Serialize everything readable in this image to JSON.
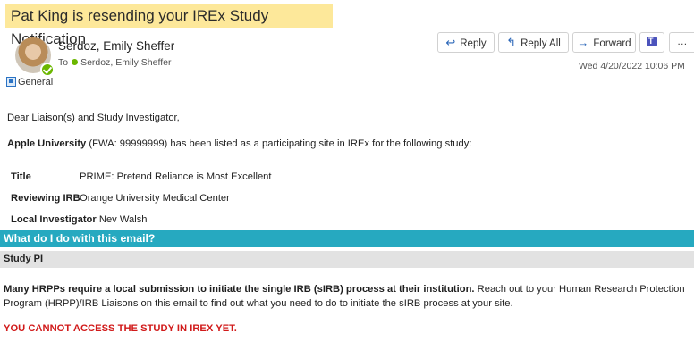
{
  "email": {
    "subject": "Pat King is resending your IREx Study Notification",
    "sender_name": "Serdoz, Emily Sheffer",
    "to_label": "To",
    "to_name": "Serdoz, Emily Sheffer",
    "category": "General",
    "date": "Wed 4/20/2022 10:06 PM"
  },
  "actions": {
    "reply": "Reply",
    "reply_all": "Reply All",
    "forward": "Forward",
    "more": "…"
  },
  "body": {
    "greeting": "Dear Liaison(s) and Study Investigator,",
    "institution": "Apple University",
    "intro_rest": " (FWA: 99999999) has been listed as a participating site in IREx for the following study:",
    "rows": [
      {
        "label": "Title",
        "value": "PRIME: Pretend Reliance is Most Excellent"
      },
      {
        "label": "Reviewing IRB",
        "value": "Orange University Medical Center"
      },
      {
        "label": "Local Investigator",
        "value": "Nev Walsh"
      }
    ],
    "section_heading": "What do I do with this email?",
    "subsection": "Study PI",
    "para_bold": "Many HRPPs require a local submission to initiate the single IRB (sIRB) process at their institution.",
    "para_rest": " Reach out to your Human Research Protection Program (HRPP)/IRB Liaisons on this email to find out what you need to do to initiate the sIRB process at your site.",
    "warning": "YOU CANNOT ACCESS THE STUDY IN IREX YET."
  },
  "colors": {
    "subject_highlight": "#fde89a",
    "section_bar": "#26a9c0",
    "subsection_bar": "#e2e2e2",
    "warning": "#d11a1a",
    "presence": "#6bb700"
  }
}
